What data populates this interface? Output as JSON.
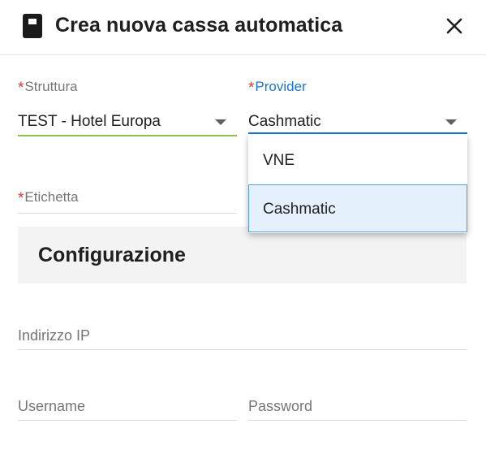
{
  "dialog": {
    "title": "Crea nuova cassa automatica"
  },
  "form": {
    "struttura": {
      "label": "Struttura",
      "value": "TEST - Hotel Europa"
    },
    "provider": {
      "label": "Provider",
      "value": "Cashmatic",
      "options": [
        "VNE",
        "Cashmatic"
      ],
      "selected_option": "Cashmatic"
    },
    "etichetta": {
      "label": "Etichetta",
      "value": ""
    },
    "configurazione": {
      "title": "Configurazione"
    },
    "indirizzo_ip": {
      "label": "Indirizzo IP",
      "value": ""
    },
    "username": {
      "label": "Username",
      "value": ""
    },
    "password": {
      "label": "Password",
      "value": ""
    }
  },
  "colors": {
    "required": "#e53935",
    "focused_label": "#1976d2",
    "valid_underline": "#8bc34a",
    "selected_option_bg": "#e4f1fc"
  },
  "icons": {
    "header": "cash-register-icon",
    "close": "close-icon",
    "dropdown": "caret-down-icon"
  }
}
